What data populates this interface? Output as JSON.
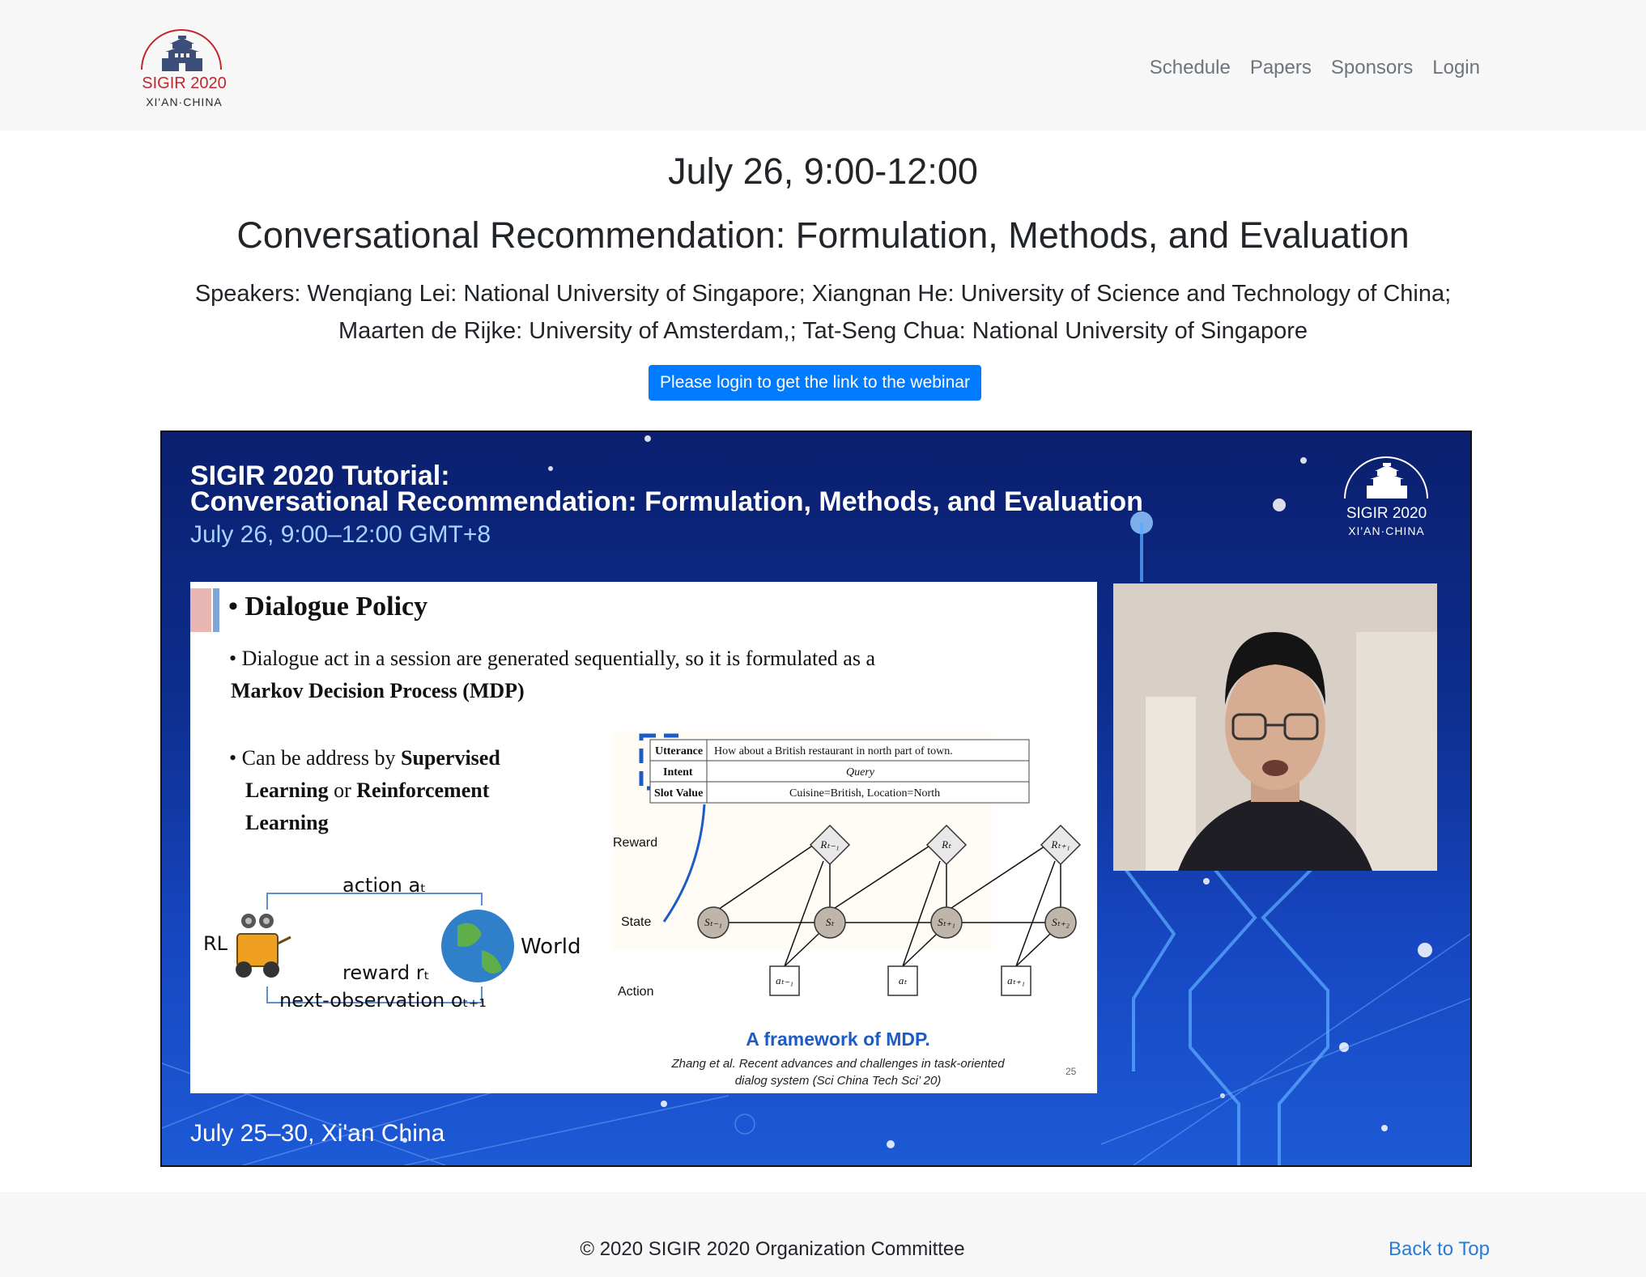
{
  "logo": {
    "line1": "SIGIR 2020",
    "line2": "XI'AN·CHINA"
  },
  "nav": {
    "items": [
      "Schedule",
      "Papers",
      "Sponsors",
      "Login"
    ]
  },
  "session": {
    "date": "July 26, 9:00-12:00",
    "title": "Conversational Recommendation: Formulation, Methods, and Evaluation",
    "speakers_line1": "Speakers: Wenqiang Lei: National University of Singapore; Xiangnan He: University of Science and Technology of China;",
    "speakers_line2": "Maarten de Rijke: University of Amsterdam,; Tat-Seng Chua: National University of Singapore",
    "login_button": "Please login to get the link to the webinar"
  },
  "video": {
    "title1": "SIGIR 2020 Tutorial:",
    "title2": "Conversational  Recommendation: Formulation, Methods, and Evaluation",
    "date": "July 26, 9:00–12:00 GMT+8",
    "logo1": "SIGIR 2020",
    "logo2": "XI'AN·CHINA",
    "footer": "July 25–30,  Xi'an China",
    "slide": {
      "heading": "• Dialogue Policy",
      "bullet1_a": "•  Dialogue act in a session are generated sequentially, so it is formulated as a",
      "bullet1_b": "Markov Decision Process (MDP)",
      "bullet2_a": "•  Can be address by ",
      "bullet2_b": "Supervised",
      "bullet2_c": "Learning",
      "bullet2_d": " or ",
      "bullet2_e": "Reinforcement",
      "bullet2_f": "Learning",
      "rl": {
        "label_rl": "RL",
        "label_world": "World",
        "action": "action aₜ",
        "reward": "reward rₜ",
        "observation": "next-observation oₜ₊₁"
      },
      "table": {
        "rows": [
          {
            "key": "Utterance",
            "val": "How about a British restaurant in north part of town."
          },
          {
            "key": "Intent",
            "val": "Query"
          },
          {
            "key": "Slot Value",
            "val": "Cuisine=British, Location=North"
          }
        ]
      },
      "mdp_labels": {
        "reward": "Reward",
        "state": "State",
        "action": "Action"
      },
      "mdp_nodes": {
        "rewards": [
          "Rₜ₋₁",
          "Rₜ",
          "Rₜ₊₁"
        ],
        "states": [
          "Sₜ₋₁",
          "Sₜ",
          "Sₜ₊₁",
          "Sₜ₊₂"
        ],
        "actions": [
          "aₜ₋₁",
          "aₜ",
          "aₜ₊₁"
        ]
      },
      "caption": "A framework of MDP.",
      "cite1": "Zhang et al. Recent advances and challenges in task-oriented",
      "cite2": "dialog system (Sci China Tech Sci’ 20)",
      "page": "25"
    }
  },
  "footer": {
    "copyright": "© 2020 SIGIR 2020 Organization Committee",
    "back_to_top": "Back to Top"
  },
  "colors": {
    "primary": "#007bff",
    "brand_red": "#c1272d",
    "link": "#2a7bd9",
    "navbar_bg": "#f7f7f8"
  }
}
